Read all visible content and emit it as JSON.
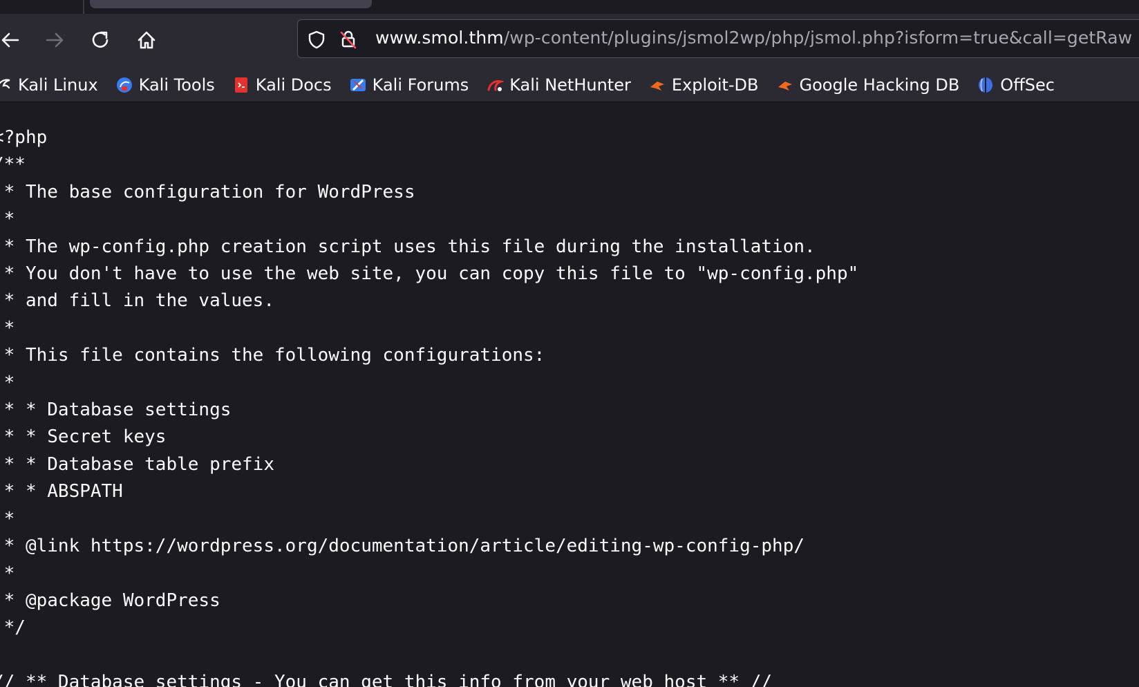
{
  "browser": {
    "url_host": "www.smol.thm",
    "url_path": "/wp-content/plugins/jsmol2wp/php/jsmol.php?isform=true&call=getRaw",
    "nav": {
      "back_icon": "arrow-left-icon",
      "forward_icon": "arrow-right-icon",
      "reload_icon": "reload-icon",
      "home_icon": "home-icon"
    },
    "bookmarks": [
      {
        "label": "Kali Linux",
        "icon": "kali-dragon-icon"
      },
      {
        "label": "Kali Tools",
        "icon": "kali-tools-icon"
      },
      {
        "label": "Kali Docs",
        "icon": "kali-docs-icon"
      },
      {
        "label": "Kali Forums",
        "icon": "kali-forums-icon"
      },
      {
        "label": "Kali NetHunter",
        "icon": "kali-nethunter-icon"
      },
      {
        "label": "Exploit-DB",
        "icon": "exploit-db-icon"
      },
      {
        "label": "Google Hacking DB",
        "icon": "google-hacking-db-icon"
      },
      {
        "label": "OffSec",
        "icon": "offsec-icon"
      }
    ]
  },
  "document": {
    "lines": [
      "<?php",
      "/**",
      " * The base configuration for WordPress",
      " *",
      " * The wp-config.php creation script uses this file during the installation.",
      " * You don't have to use the web site, you can copy this file to \"wp-config.php\"",
      " * and fill in the values.",
      " *",
      " * This file contains the following configurations:",
      " *",
      " * * Database settings",
      " * * Secret keys",
      " * * Database table prefix",
      " * * ABSPATH",
      " *",
      " * @link https://wordpress.org/documentation/article/editing-wp-config-php/",
      " *",
      " * @package WordPress",
      " */",
      "",
      "// ** Database settings - You can get this info from your web host ** //"
    ]
  },
  "colors": {
    "toolbar_bg": "#2b2a33",
    "page_bg": "#1c1b22",
    "text": "#fbfbfe",
    "url_dim": "#a8a7b0"
  }
}
